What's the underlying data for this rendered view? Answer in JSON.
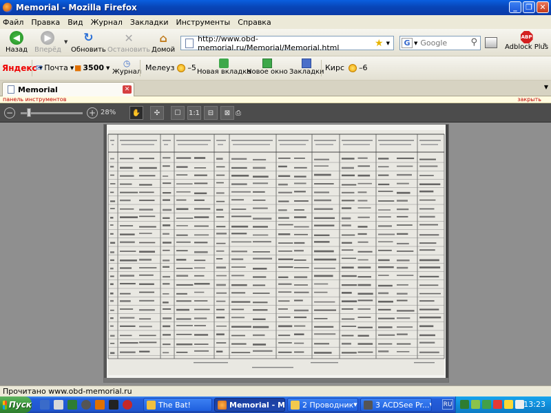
{
  "window": {
    "title": "Memorial - Mozilla Firefox"
  },
  "menu": [
    "Файл",
    "Правка",
    "Вид",
    "Журнал",
    "Закладки",
    "Инструменты",
    "Справка"
  ],
  "nav": {
    "back": "Назад",
    "forward": "Вперёд",
    "reload": "Обновить",
    "stop": "Остановить",
    "home": "Домой",
    "url": "http://www.obd-memorial.ru/Memorial/Memorial.html",
    "search_engine": "G",
    "search_placeholder": "Google",
    "adblock": "Adblock Plus",
    "adblock_icon_text": "ABP"
  },
  "yandex": {
    "logo": "Яндекс",
    "mail": "Почта",
    "points": "3500",
    "journal": "Журнал",
    "city1": "Мелеуз",
    "temp1": "–5",
    "new_tab": "Новая вкладка",
    "new_window": "Новое окно",
    "bookmarks": "Закладки",
    "city2": "Кирс",
    "temp2": "–6"
  },
  "tab": {
    "label": "Memorial"
  },
  "notification": {
    "left": "панель инструментов",
    "right": "закрыть"
  },
  "viewer": {
    "zoom": "28%",
    "btn_fit_width": "1:1"
  },
  "status": "Прочитано www.obd-memorial.ru",
  "taskbar": {
    "start": "Пуск",
    "tasks": [
      {
        "label": "The Bat!",
        "active": false
      },
      {
        "label": "Memorial - M...",
        "active": true
      },
      {
        "label": "2 Проводник",
        "active": false
      },
      {
        "label": "3 ACDSee Pr...",
        "active": false
      }
    ],
    "lang": "RU",
    "clock": "13:23"
  },
  "colors": {
    "titlebar": "#0846b8",
    "taskbar": "#245edb",
    "start": "#3c9a3c",
    "viewer_bg": "#8f8f8f",
    "viewer_toolbar": "#4c4c4c"
  }
}
